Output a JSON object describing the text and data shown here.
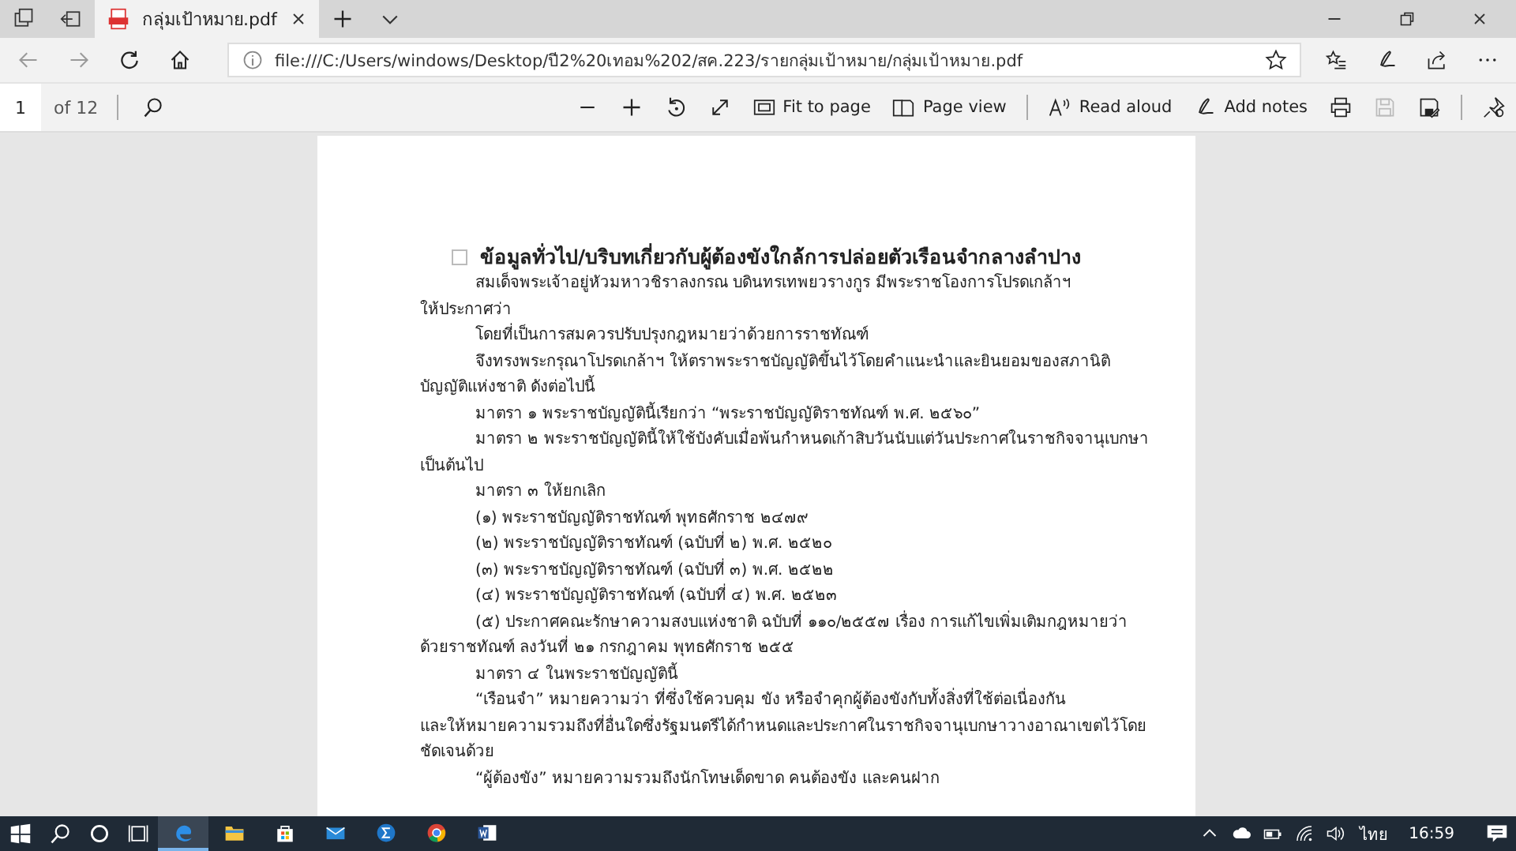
{
  "tab": {
    "title": "กลุ่มเป้าหมาย.pdf",
    "selected": true
  },
  "address_bar": {
    "url": "file:///C:/Users/windows/Desktop/ปี2%20เทอม%202/สค.223/รายกลุ่มเป้าหมาย/กลุ่มเป้าหมาย.pdf"
  },
  "pdf_toolbar": {
    "page": "1",
    "page_count": "of 12",
    "buttons": [
      {
        "kind": "fit",
        "label": "Fit to page"
      },
      {
        "kind": "view",
        "label": "Page view"
      },
      {
        "kind": "read",
        "label": "Read aloud"
      },
      {
        "kind": "notes",
        "label": "Add notes"
      }
    ],
    "save_disabled": true
  },
  "document": {
    "heading": "ข้อมูลทั่วไป/บริบทเกี่ยวกับผู้ต้องขังใกล้การปล่อยตัวเรือนจำกลางลำปาง",
    "lines": [
      {
        "kind": "first",
        "text": "สมเด็จพระเจ้าอยู่หัวมหาวชิราลงกรณ บดินทรเทพยวรางกูร มีพระราชโองการโปรดเกล้าฯ"
      },
      {
        "kind": "cont",
        "text": "ให้ประกาศว่า"
      },
      {
        "kind": "first",
        "text": "โดยที่เป็นการสมควรปรับปรุงกฎหมายว่าด้วยการราชทัณฑ์"
      },
      {
        "kind": "first",
        "text": "จึงทรงพระกรุณาโปรดเกล้าฯ ให้ตราพระราชบัญญัติขึ้นไว้โดยคำแนะนำและยินยอมของสภานิติ"
      },
      {
        "kind": "cont",
        "text": "บัญญัติแห่งชาติ ดังต่อไปนี้"
      },
      {
        "kind": "first",
        "text": "มาตรา ๑ พระราชบัญญัตินี้เรียกว่า “พระราชบัญญัติราชทัณฑ์ พ.ศ. ๒๕๖๐”"
      },
      {
        "kind": "first",
        "text": "มาตรา ๒ พระราชบัญญัตินี้ให้ใช้บังคับเมื่อพ้นกำหนดเก้าสิบวันนับแต่วันประกาศในราชกิจจานุเบกษา"
      },
      {
        "kind": "cont",
        "text": "เป็นต้นไป"
      },
      {
        "kind": "first",
        "text": "มาตรา ๓ ให้ยกเลิก"
      },
      {
        "kind": "first",
        "text": "(๑) พระราชบัญญัติราชทัณฑ์ พุทธศักราช ๒๔๗๙"
      },
      {
        "kind": "first",
        "text": "(๒) พระราชบัญญัติราชทัณฑ์ (ฉบับที่ ๒) พ.ศ. ๒๕๒๐"
      },
      {
        "kind": "first",
        "text": "(๓) พระราชบัญญัติราชทัณฑ์ (ฉบับที่ ๓) พ.ศ. ๒๕๒๒"
      },
      {
        "kind": "first",
        "text": "(๔) พระราชบัญญัติราชทัณฑ์ (ฉบับที่ ๔) พ.ศ. ๒๕๒๓"
      },
      {
        "kind": "first",
        "text": "(๕) ประกาศคณะรักษาความสงบแห่งชาติ ฉบับที่ ๑๑๐/๒๕๕๗ เรื่อง การแก้ไขเพิ่มเติมกฎหมายว่า"
      },
      {
        "kind": "cont",
        "text": "ด้วยราชทัณฑ์ ลงวันที่ ๒๑ กรกฎาคม พุทธศักราช ๒๕๕"
      },
      {
        "kind": "first",
        "text": "มาตรา ๔ ในพระราชบัญญัตินี้"
      },
      {
        "kind": "first",
        "text": "“เรือนจำ” หมายความว่า ที่ซึ่งใช้ควบคุม ขัง หรือจำคุกผู้ต้องขังกับทั้งสิ่งที่ใช้ต่อเนื่องกัน"
      },
      {
        "kind": "cont",
        "text": "และให้หมายความรวมถึงที่อื่นใดซึ่งรัฐมนตรีได้กำหนดและประกาศในราชกิจจานุเบกษาวางอาณาเขตไว้โดย"
      },
      {
        "kind": "cont",
        "text": "ชัดเจนด้วย"
      },
      {
        "kind": "first",
        "text": "“ผู้ต้องขัง” หมายความรวมถึงนักโทษเด็ดขาด คนต้องขัง และคนฝาก"
      }
    ]
  },
  "taskbar": {
    "language": "ไทย",
    "time": "16:59"
  }
}
